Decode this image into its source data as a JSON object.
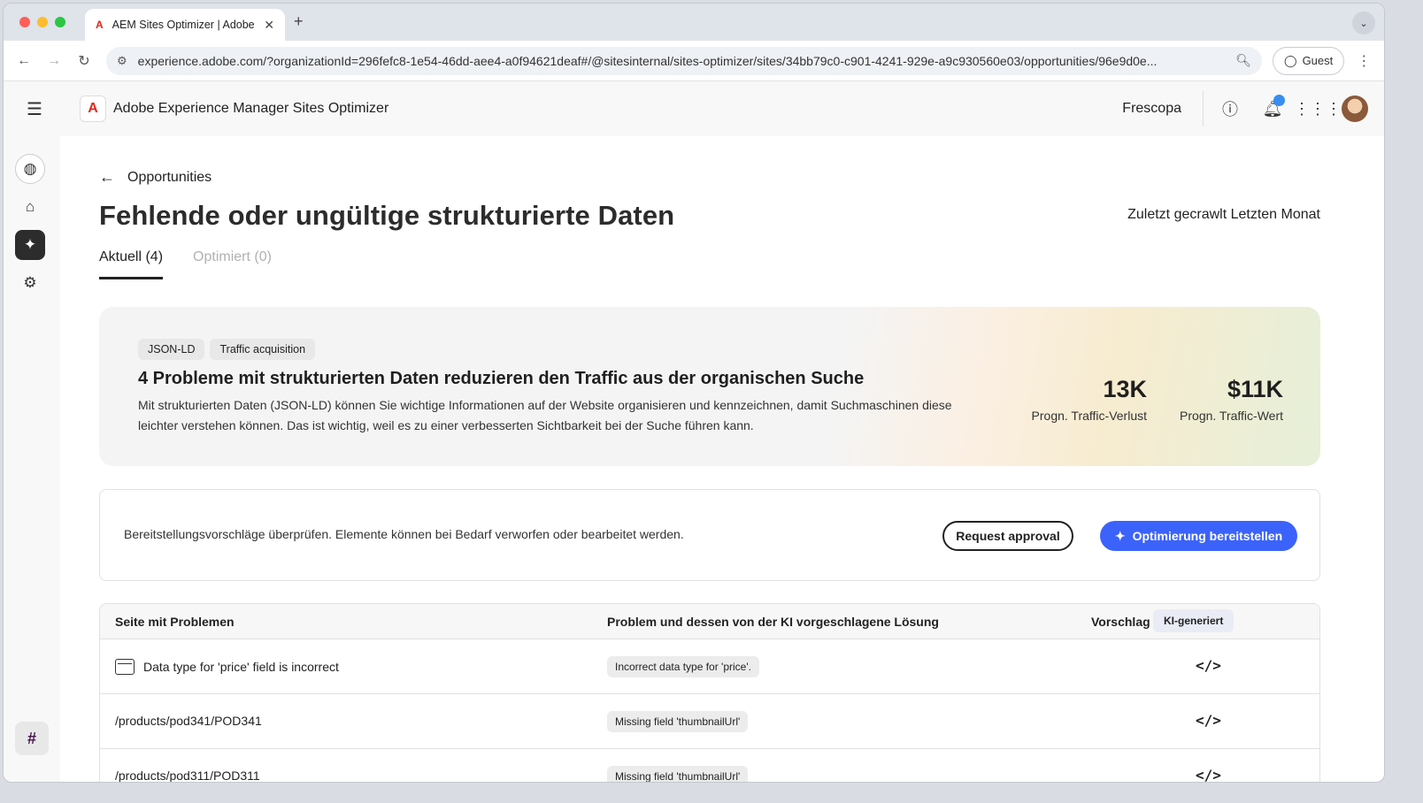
{
  "browser": {
    "tab_title": "AEM Sites Optimizer | Adobe",
    "tab_favicon": "A",
    "url": "experience.adobe.com/?organizationId=296fefc8-1e54-46dd-aee4-a0f94621deaf#/@sitesinternal/sites-optimizer/sites/34bb79c0-c901-4241-929e-a9c930560e03/opportunities/96e9d0e...",
    "guest_label": "Guest"
  },
  "app": {
    "title": "Adobe Experience Manager Sites Optimizer",
    "org_name": "Frescopa",
    "accent_color": "#3b63fb",
    "brand_color": "#e1251b"
  },
  "page": {
    "back_label": "Opportunities",
    "title": "Fehlende oder ungültige strukturierte Daten",
    "last_crawled": "Zuletzt gecrawlt Letzten Monat",
    "tabs": [
      {
        "label": "Aktuell (4)",
        "active": true
      },
      {
        "label": "Optimiert (0)",
        "active": false
      }
    ]
  },
  "hero": {
    "chips": [
      "JSON-LD",
      "Traffic acquisition"
    ],
    "headline": "4 Probleme mit strukturierten Daten reduzieren den Traffic aus der organischen Suche",
    "description": "Mit strukturierten Daten (JSON-LD) können Sie wichtige Informationen auf der Website organisieren und kennzeichnen, damit Suchmaschinen diese leichter verstehen können. Das ist wichtig, weil es zu einer verbesserten Sichtbarkeit bei der Suche führen kann.",
    "stats": [
      {
        "value": "13K",
        "label": "Progn. Traffic-Verlust"
      },
      {
        "value": "$11K",
        "label": "Progn. Traffic-Wert"
      }
    ]
  },
  "actions": {
    "message": "Bereitstellungsvorschläge überprüfen. Elemente können bei Bedarf verworfen oder bearbeitet werden.",
    "request_approval": "Request approval",
    "deploy": "Optimierung bereitstellen"
  },
  "table": {
    "headers": {
      "page": "Seite mit Problemen",
      "problem": "Problem und dessen von der KI vorgeschlagene Lösung",
      "suggestion": "Vorschlag",
      "ai_badge": "KI-generiert"
    },
    "rows": [
      {
        "page": "Data type for 'price' field is incorrect",
        "has_icon": true,
        "problem": "Incorrect data type for 'price'.",
        "action": "</>"
      },
      {
        "page": "/products/pod341/POD341",
        "has_icon": false,
        "problem": "Missing field 'thumbnailUrl'",
        "action": "</>"
      },
      {
        "page": "/products/pod311/POD311",
        "has_icon": false,
        "problem": "Missing field 'thumbnailUrl'",
        "action": "</>"
      }
    ]
  }
}
